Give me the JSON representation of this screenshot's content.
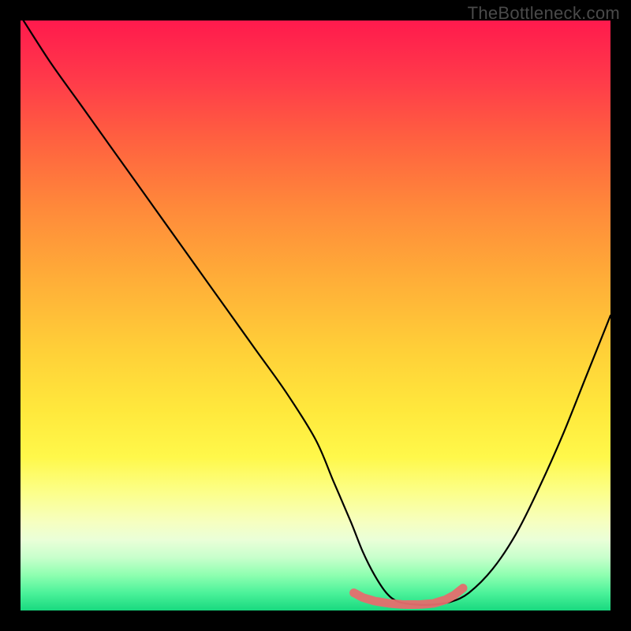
{
  "watermark": "TheBottleneck.com",
  "colors": {
    "background": "#000000",
    "curve_stroke": "#000000",
    "marker_fill": "#e56e6e",
    "marker_stroke": "#c85a5a"
  },
  "chart_data": {
    "type": "line",
    "title": "",
    "xlabel": "",
    "ylabel": "",
    "xlim": [
      0,
      100
    ],
    "ylim": [
      0,
      100
    ],
    "grid": false,
    "legend": false,
    "annotations": [
      "TheBottleneck.com"
    ],
    "series": [
      {
        "name": "bottleneck-curve",
        "x": [
          0.5,
          5,
          10,
          15,
          20,
          25,
          30,
          35,
          40,
          45,
          50,
          53,
          56,
          58,
          60,
          62,
          64,
          67,
          70,
          73,
          76,
          80,
          84,
          88,
          92,
          96,
          100
        ],
        "y": [
          100,
          93,
          86,
          79,
          72,
          65,
          58,
          51,
          44,
          37,
          29,
          22,
          15,
          10,
          6,
          3,
          1.5,
          1,
          1,
          1.5,
          3,
          7,
          13,
          21,
          30,
          40,
          50
        ]
      }
    ],
    "markers": {
      "name": "trough-markers",
      "points": [
        {
          "x": 56.5,
          "y": 3.0
        },
        {
          "x": 58.0,
          "y": 2.2
        },
        {
          "x": 60.0,
          "y": 1.6
        },
        {
          "x": 62.5,
          "y": 1.2
        },
        {
          "x": 65.0,
          "y": 1.0
        },
        {
          "x": 67.5,
          "y": 1.0
        },
        {
          "x": 70.0,
          "y": 1.2
        },
        {
          "x": 72.0,
          "y": 1.8
        },
        {
          "x": 73.5,
          "y": 2.6
        },
        {
          "x": 75.0,
          "y": 3.8
        }
      ]
    }
  }
}
